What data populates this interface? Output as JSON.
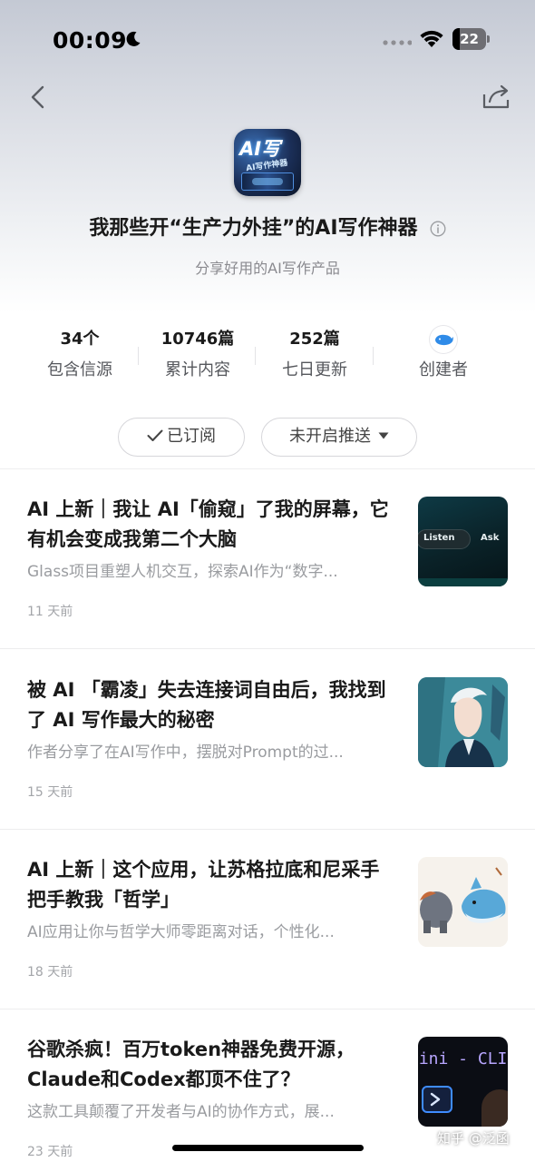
{
  "status_bar": {
    "time": "00:09",
    "battery_level": "22"
  },
  "header": {
    "title": "我那些开“生产力外挂”的AI写作神器",
    "subtitle": "分享好用的AI写作产品",
    "logo_text_big": "AI写",
    "logo_text_small": "AI写作神器"
  },
  "stats": [
    {
      "value": "34个",
      "label": "包含信源"
    },
    {
      "value": "10746篇",
      "label": "累计内容"
    },
    {
      "value": "252篇",
      "label": "七日更新"
    }
  ],
  "creator": {
    "label": "创建者"
  },
  "actions": {
    "subscribed_label": "已订阅",
    "push_label": "未开启推送"
  },
  "articles": [
    {
      "title": "AI 上新｜我让 AI「偷窥」了我的屏幕，它有机会变成我第二个大脑",
      "summary": "Glass项目重塑人机交互，探索AI作为“数字...",
      "time": "11 天前",
      "thumb_text": [
        "Listen",
        "Ask"
      ]
    },
    {
      "title": "被 AI 「霸凌」失去连接词自由后，我找到了 AI 写作最大的秘密",
      "summary": "作者分享了在AI写作中，摆脱对Prompt的过...",
      "time": "15 天前"
    },
    {
      "title": "AI 上新｜这个应用，让苏格拉底和尼采手把手教我「哲学」",
      "summary": "AI应用让你与哲学大师零距离对话，个性化...",
      "time": "18 天前"
    },
    {
      "title": "谷歌杀疯！百万token神器免费开源，Claude和Codex都顶不住了？",
      "summary": "这款工具颠覆了开发者与AI的协作方式，展...",
      "time": "23 天前",
      "thumb_text": [
        "mini - CLI"
      ]
    }
  ],
  "watermark": "知乎 @泛函",
  "colors": {
    "accent_blue": "#2f8be8",
    "text_primary": "#1a1a1a",
    "text_muted": "#9a9ca0"
  },
  "icons": [
    "moon-icon",
    "wifi-icon",
    "battery-icon",
    "back-arrow-icon",
    "share-icon",
    "info-icon",
    "check-icon",
    "caret-down-icon",
    "whale-icon"
  ]
}
